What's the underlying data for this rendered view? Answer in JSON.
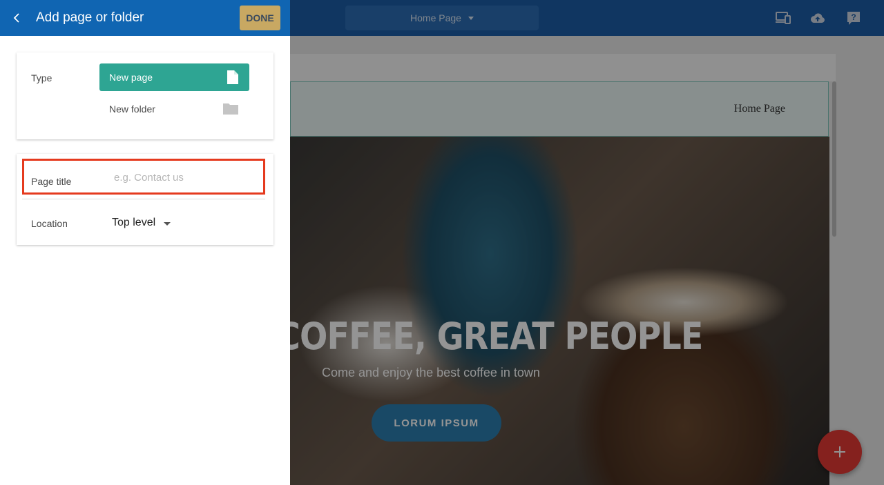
{
  "panel": {
    "title": "Add page or folder",
    "done_label": "DONE"
  },
  "type_card": {
    "type_label": "Type",
    "options": [
      {
        "label": "New page",
        "icon": "file-icon",
        "selected": true
      },
      {
        "label": "New folder",
        "icon": "folder-icon",
        "selected": false
      }
    ]
  },
  "fields": {
    "page_title_label": "Page title",
    "page_title_value": "",
    "page_title_placeholder": "e.g. Contact us",
    "location_label": "Location",
    "location_value": "Top level"
  },
  "topbar": {
    "page_select": "Home Page",
    "icons": [
      "devices-icon",
      "cloud-upload-icon",
      "help-icon"
    ]
  },
  "preview": {
    "nav_item": "Home Page",
    "hero_title": "COFFEE, GREAT PEOPLE",
    "hero_subtitle": "Come and enjoy the best coffee in town",
    "hero_button": "LORUM IPSUM",
    "fab_icon": "plus-icon"
  },
  "colors": {
    "header_blue": "#1065b2",
    "accent_teal": "#2ea593",
    "done_gold": "#c8a862",
    "highlight_red": "#e53a1e",
    "fab_red": "#e53935"
  }
}
